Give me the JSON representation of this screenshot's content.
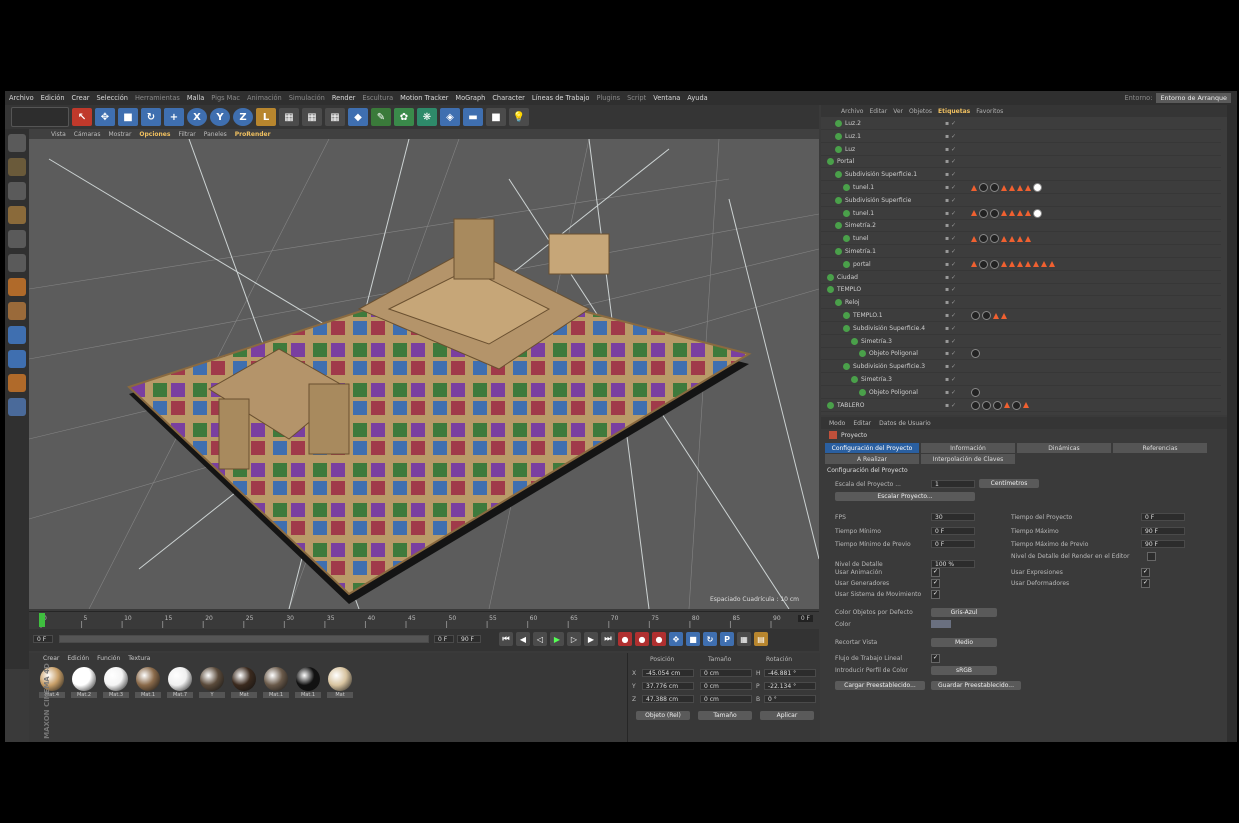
{
  "menubar": {
    "items": [
      "Archivo",
      "Edición",
      "Crear",
      "Selección",
      "Herramientas",
      "Malla",
      "Pigs Mac",
      "Animación",
      "Simulación",
      "Render",
      "Escultura",
      "Motion Tracker",
      "MoGraph",
      "Character",
      "Líneas de Trabajo",
      "Plugins",
      "Script",
      "Ventana",
      "Ayuda"
    ],
    "layout_label": "Entorno:",
    "layout_value": "Entorno de Arranque"
  },
  "viewport": {
    "menu": [
      "Vista",
      "Cámaras",
      "Mostrar",
      "Opciones",
      "Filtrar",
      "Paneles",
      "ProRender"
    ],
    "status": "Espaciado Cuadrícula : 10 cm"
  },
  "timeline": {
    "ticks": [
      "0",
      "5",
      "10",
      "15",
      "20",
      "25",
      "30",
      "35",
      "40",
      "45",
      "50",
      "55",
      "60",
      "65",
      "70",
      "75",
      "80",
      "85",
      "90"
    ],
    "end_label": "0 F",
    "start_field": "0 F",
    "range_start": "0 F",
    "range_end": "90 F"
  },
  "materials": {
    "menu": [
      "Crear",
      "Edición",
      "Función",
      "Textura"
    ],
    "items": [
      {
        "label": "Mat.4",
        "color": "#c9a069"
      },
      {
        "label": "Mat.2",
        "color": "#ffffff"
      },
      {
        "label": "Mat.3",
        "color": "#f4f4f4"
      },
      {
        "label": "Mat.1",
        "color": "#8a6a4a"
      },
      {
        "label": "Mat.7",
        "color": "#f0f0f0"
      },
      {
        "label": "Y",
        "color": "#5a4a3a"
      },
      {
        "label": "Mat",
        "color": "#3b2a1e"
      },
      {
        "label": "Mat.1",
        "color": "#6a5a4a"
      },
      {
        "label": "Mat.1",
        "color": "#111111"
      },
      {
        "label": "Mat",
        "color": "#d8c4a0"
      }
    ],
    "brand": "MAXON CINEMA 4D"
  },
  "coords": {
    "headers": [
      "Posición",
      "Tamaño",
      "Rotación"
    ],
    "rows": [
      {
        "axis": "X",
        "pos": "-45.054 cm",
        "size": "0 cm",
        "rotLabel": "H",
        "rot": "-46.881 °"
      },
      {
        "axis": "Y",
        "pos": "37.776 cm",
        "size": "0 cm",
        "rotLabel": "P",
        "rot": "-22.134 °"
      },
      {
        "axis": "Z",
        "pos": "47.388 cm",
        "size": "0 cm",
        "rotLabel": "B",
        "rot": "0 °"
      }
    ],
    "mode": "Objeto (Rel)",
    "size_mode": "Tamaño",
    "apply": "Aplicar"
  },
  "objectManager": {
    "tabs": [
      "Archivo",
      "Editar",
      "Ver",
      "Objetos",
      "Etiquetas",
      "Favoritos"
    ],
    "rows": [
      {
        "name": "Luz.2",
        "indent": 1,
        "tags": []
      },
      {
        "name": "Luz.1",
        "indent": 1,
        "tags": []
      },
      {
        "name": "Luz",
        "indent": 1,
        "tags": []
      },
      {
        "name": "Portal",
        "indent": 0,
        "tags": []
      },
      {
        "name": "Subdivisión Superficie.1",
        "indent": 1,
        "tags": []
      },
      {
        "name": "tunel.1",
        "indent": 2,
        "tags": [
          "t",
          "d",
          "d",
          "t",
          "t",
          "t",
          "t",
          "w"
        ]
      },
      {
        "name": "Subdivisión Superficie",
        "indent": 1,
        "tags": []
      },
      {
        "name": "tunel.1",
        "indent": 2,
        "tags": [
          "t",
          "d",
          "d",
          "t",
          "t",
          "t",
          "t",
          "w"
        ]
      },
      {
        "name": "Simetría.2",
        "indent": 1,
        "tags": []
      },
      {
        "name": "tunel",
        "indent": 2,
        "tags": [
          "t",
          "d",
          "d",
          "t",
          "t",
          "t",
          "t"
        ]
      },
      {
        "name": "Simetría.1",
        "indent": 1,
        "tags": []
      },
      {
        "name": "portal",
        "indent": 2,
        "tags": [
          "t",
          "d",
          "d",
          "t",
          "t",
          "t",
          "t",
          "t",
          "t",
          "t"
        ]
      },
      {
        "name": "Ciudad",
        "indent": 0,
        "tags": []
      },
      {
        "name": "TEMPLO",
        "indent": 0,
        "tags": []
      },
      {
        "name": "Reloj",
        "indent": 1,
        "tags": []
      },
      {
        "name": "TEMPLO.1",
        "indent": 2,
        "tags": [
          "d",
          "d",
          "t",
          "t"
        ]
      },
      {
        "name": "Subdivisión Superficie.4",
        "indent": 2,
        "tags": []
      },
      {
        "name": "Simetría.3",
        "indent": 3,
        "tags": []
      },
      {
        "name": "Objeto Poligonal",
        "indent": 4,
        "tags": [
          "d"
        ]
      },
      {
        "name": "Subdivisión Superficie.3",
        "indent": 2,
        "tags": []
      },
      {
        "name": "Simetría.3",
        "indent": 3,
        "tags": []
      },
      {
        "name": "Objeto Poligonal",
        "indent": 4,
        "tags": [
          "d"
        ]
      },
      {
        "name": "TABLERO",
        "indent": 0,
        "tags": [
          "d",
          "d",
          "d",
          "t",
          "d",
          "t"
        ]
      }
    ]
  },
  "attributes": {
    "menu": [
      "Modo",
      "Editar",
      "Datos de Usuario"
    ],
    "title": "Proyecto",
    "tabs": [
      "Configuración del Proyecto",
      "Información",
      "Dinámicas",
      "Referencias",
      "A Realizar",
      "Interpolación de Claves"
    ],
    "section": "Configuración del Proyecto",
    "scale_label": "Escala del Proyecto ...",
    "scale_value": "1",
    "scale_unit": "Centímetros",
    "scale_button": "Escalar Proyecto...",
    "left": [
      {
        "label": "FPS",
        "value": "30"
      },
      {
        "label": "Tiempo Mínimo",
        "value": "0 F"
      },
      {
        "label": "Tiempo Mínimo de Previo",
        "value": "0 F"
      },
      {
        "label": "Nivel de Detalle",
        "value": "100 %"
      }
    ],
    "right": [
      {
        "label": "Tiempo del Proyecto",
        "value": "0 F"
      },
      {
        "label": "Tiempo Máximo",
        "value": "90 F"
      },
      {
        "label": "Tiempo Máximo de Previo",
        "value": "90 F"
      }
    ],
    "render_detail": "Nivel de Detalle del Render en el Editor",
    "checks_left": [
      "Usar Animación",
      "Usar Generadores",
      "Usar Sistema de Movimiento"
    ],
    "checks_right": [
      "Usar Expresiones",
      "Usar Deformadores"
    ],
    "default_color_label": "Color Objetos por Defecto",
    "default_color_value": "Gris-Azul",
    "color_label": "Color",
    "clip_label": "Recortar Vista",
    "clip_value": "Medio",
    "linear_label": "Flujo de Trabajo Lineal",
    "profile_label": "Introducir Perfil de Color",
    "profile_value": "sRGB",
    "load_btn": "Cargar Preestablecido...",
    "save_btn": "Guardar Preestablecido..."
  }
}
